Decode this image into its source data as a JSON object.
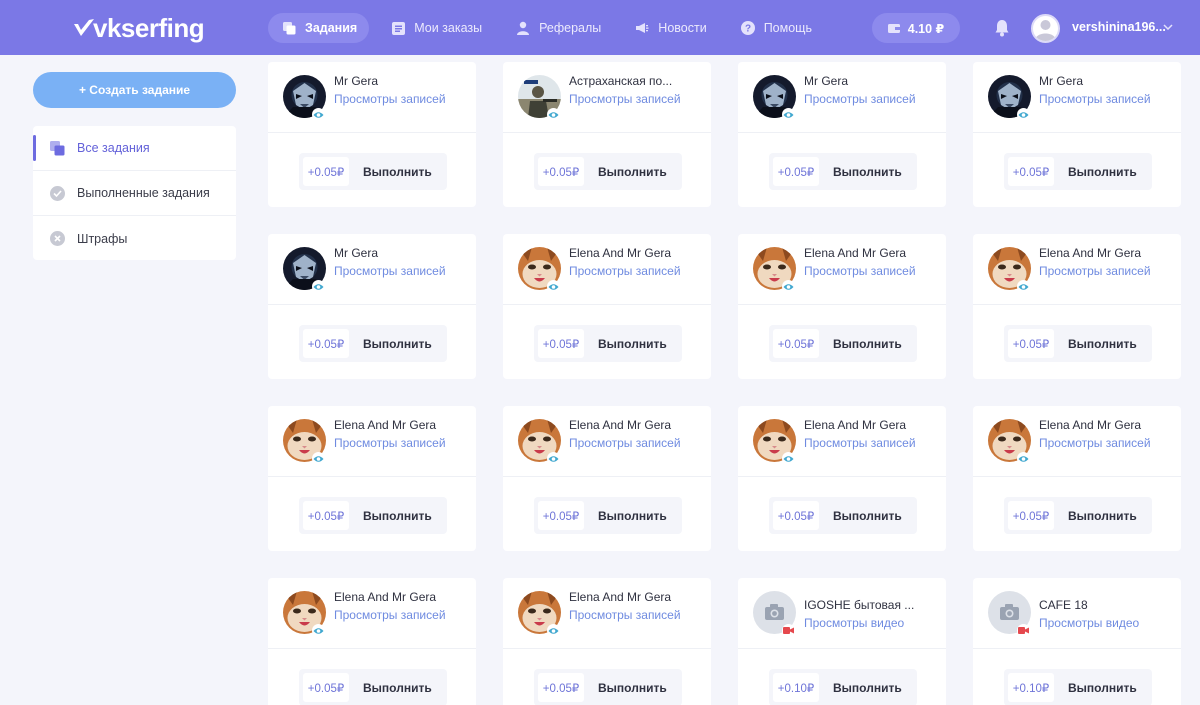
{
  "header": {
    "logo": "vkserfing",
    "nav": [
      {
        "label": "Задания",
        "icon": "tasks-icon",
        "active": true
      },
      {
        "label": "Мои заказы",
        "icon": "orders-icon",
        "active": false
      },
      {
        "label": "Рефералы",
        "icon": "referrals-icon",
        "active": false
      },
      {
        "label": "Новости",
        "icon": "news-icon",
        "active": false
      },
      {
        "label": "Помощь",
        "icon": "help-icon",
        "active": false
      }
    ],
    "balance": "4.10 ₽",
    "username": "vershinina196..."
  },
  "sidebar": {
    "create_button": "+ Создать задание",
    "menu": [
      {
        "label": "Все задания",
        "icon": "all-tasks-icon",
        "active": true
      },
      {
        "label": "Выполненные задания",
        "icon": "check-circle-icon",
        "active": false
      },
      {
        "label": "Штрафы",
        "icon": "close-circle-icon",
        "active": false
      }
    ]
  },
  "colors": {
    "header": "#7b78e6",
    "accent_blue": "#7ab1f5",
    "link": "#6f8be0",
    "page_bg": "#f4f5fb"
  },
  "tasks": [
    {
      "name": "Mr Gera",
      "type": "Просмотры записей",
      "price": "+0.05₽",
      "action": "Выполнить",
      "avatar": "mask-avatar",
      "badge": "eye-icon"
    },
    {
      "name": "Астраханская по...",
      "type": "Просмотры записей",
      "price": "+0.05₽",
      "action": "Выполнить",
      "avatar": "soldier-avatar",
      "badge": "eye-icon"
    },
    {
      "name": "Mr Gera",
      "type": "Просмотры записей",
      "price": "+0.05₽",
      "action": "Выполнить",
      "avatar": "mask-avatar",
      "badge": "eye-icon"
    },
    {
      "name": "Mr Gera",
      "type": "Просмотры записей",
      "price": "+0.05₽",
      "action": "Выполнить",
      "avatar": "mask-avatar",
      "badge": "eye-icon"
    },
    {
      "name": "Mr Gera",
      "type": "Просмотры записей",
      "price": "+0.05₽",
      "action": "Выполнить",
      "avatar": "mask-avatar",
      "badge": "eye-icon"
    },
    {
      "name": "Elena And Mr Gera",
      "type": "Просмотры записей",
      "price": "+0.05₽",
      "action": "Выполнить",
      "avatar": "cat-avatar",
      "badge": "eye-icon"
    },
    {
      "name": "Elena And Mr Gera",
      "type": "Просмотры записей",
      "price": "+0.05₽",
      "action": "Выполнить",
      "avatar": "cat-avatar",
      "badge": "eye-icon"
    },
    {
      "name": "Elena And Mr Gera",
      "type": "Просмотры записей",
      "price": "+0.05₽",
      "action": "Выполнить",
      "avatar": "cat-avatar",
      "badge": "eye-icon"
    },
    {
      "name": "Elena And Mr Gera",
      "type": "Просмотры записей",
      "price": "+0.05₽",
      "action": "Выполнить",
      "avatar": "cat-avatar",
      "badge": "eye-icon"
    },
    {
      "name": "Elena And Mr Gera",
      "type": "Просмотры записей",
      "price": "+0.05₽",
      "action": "Выполнить",
      "avatar": "cat-avatar",
      "badge": "eye-icon"
    },
    {
      "name": "Elena And Mr Gera",
      "type": "Просмотры записей",
      "price": "+0.05₽",
      "action": "Выполнить",
      "avatar": "cat-avatar",
      "badge": "eye-icon"
    },
    {
      "name": "Elena And Mr Gera",
      "type": "Просмотры записей",
      "price": "+0.05₽",
      "action": "Выполнить",
      "avatar": "cat-avatar",
      "badge": "eye-icon"
    },
    {
      "name": "Elena And Mr Gera",
      "type": "Просмотры записей",
      "price": "+0.05₽",
      "action": "Выполнить",
      "avatar": "cat-avatar",
      "badge": "eye-icon"
    },
    {
      "name": "Elena And Mr Gera",
      "type": "Просмотры записей",
      "price": "+0.05₽",
      "action": "Выполнить",
      "avatar": "cat-avatar",
      "badge": "eye-icon"
    },
    {
      "name": "IGOSHE бытовая ...",
      "type": "Просмотры видео",
      "price": "+0.10₽",
      "action": "Выполнить",
      "avatar": "camera-avatar",
      "badge": "video-icon"
    },
    {
      "name": "CAFE 18",
      "type": "Просмотры видео",
      "price": "+0.10₽",
      "action": "Выполнить",
      "avatar": "camera-avatar",
      "badge": "video-icon"
    }
  ]
}
